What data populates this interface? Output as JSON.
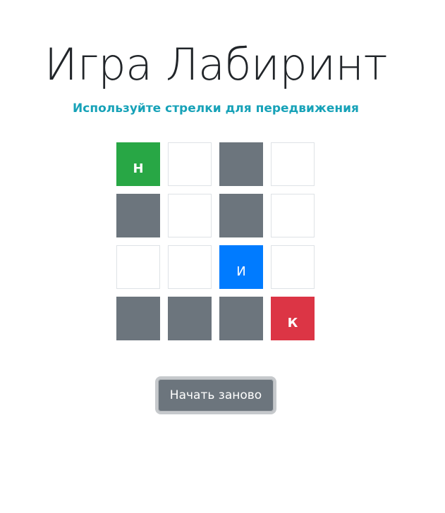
{
  "title": "Игра Лабиринт",
  "subtitle": "Используйте стрелки для передвижения",
  "maze": {
    "rows": 4,
    "cols": 4,
    "cells": [
      [
        "start",
        "open",
        "wall",
        "open"
      ],
      [
        "wall",
        "open",
        "wall",
        "open"
      ],
      [
        "open",
        "open",
        "player",
        "open"
      ],
      [
        "wall",
        "wall",
        "wall",
        "finish"
      ]
    ],
    "labels": {
      "start": "Н",
      "player": "И",
      "finish": "К"
    },
    "colors": {
      "start": "#28a745",
      "player": "#007bff",
      "finish": "#dc3545",
      "wall": "#6c757d",
      "open": "#ffffff"
    }
  },
  "restart_button": {
    "label": "Начать заново"
  }
}
